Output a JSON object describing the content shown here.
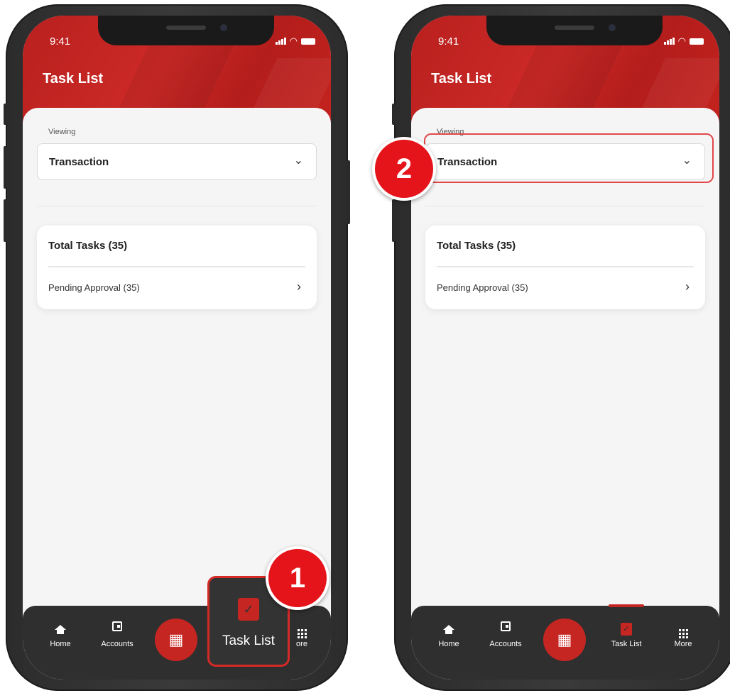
{
  "status_bar": {
    "time": "9:41"
  },
  "header": {
    "title": "Task List"
  },
  "viewing_label": "Viewing",
  "selector": {
    "value": "Transaction",
    "chevron": "chevron-down-icon"
  },
  "summary_card": {
    "title": "Total Tasks (35)",
    "rows": [
      {
        "label": "Pending Approval (35)"
      }
    ]
  },
  "tabbar": {
    "items": [
      {
        "label": "Home",
        "icon": "home-icon"
      },
      {
        "label": "Accounts",
        "icon": "wallet-icon"
      },
      {
        "label": "",
        "icon": "qr-code-icon"
      },
      {
        "label": "Task List",
        "icon": "clipboard-check-icon"
      },
      {
        "label": "More",
        "icon": "grid-icon"
      }
    ],
    "left_more_partial": "ore"
  },
  "callouts": {
    "step1": "1",
    "step2": "2",
    "zoom_label": "Task List"
  },
  "colors": {
    "brand_red": "#c62622",
    "callout_red": "#e5141b",
    "tabbar_bg": "#2f2f2f"
  }
}
